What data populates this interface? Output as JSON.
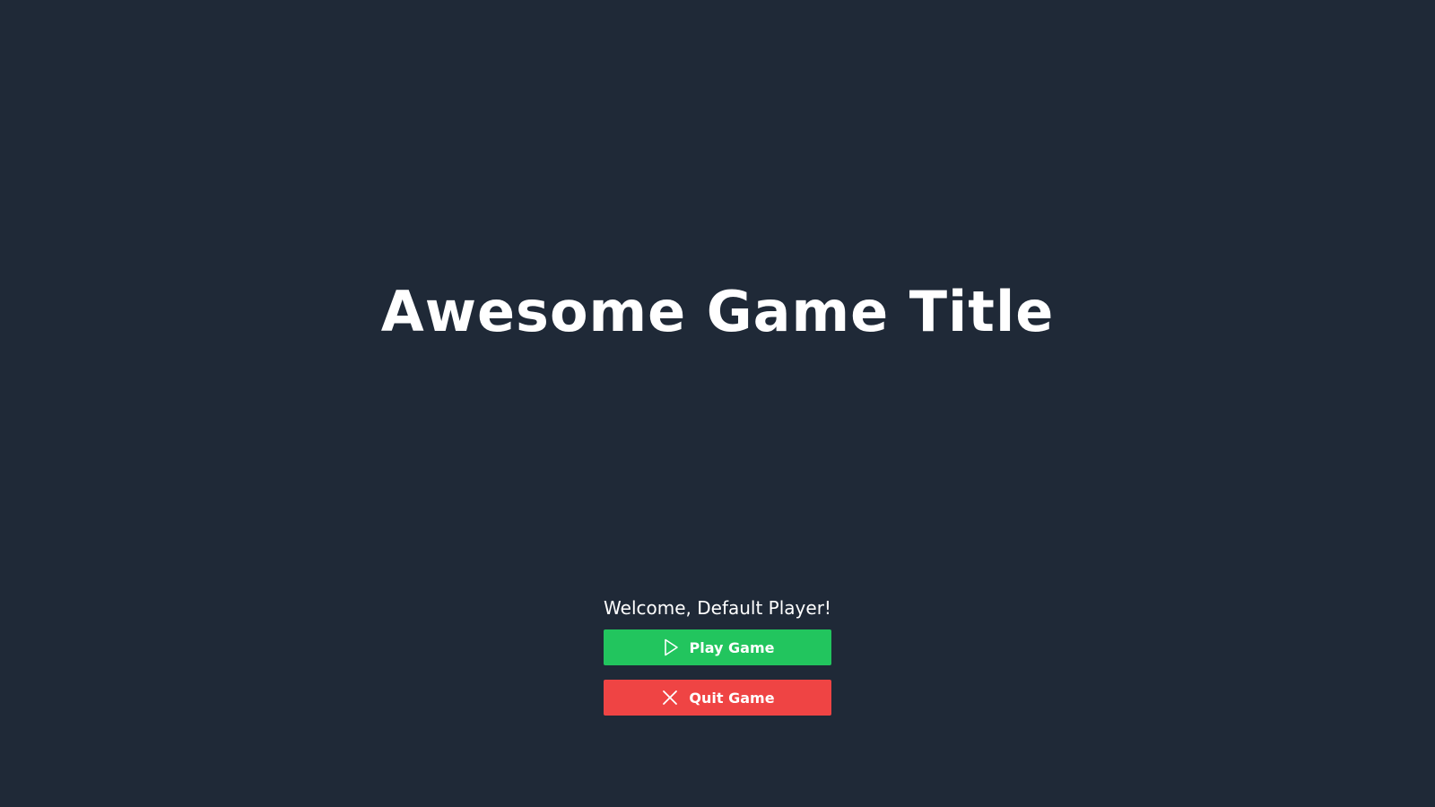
{
  "title": "Awesome Game Title",
  "welcome_text": "Welcome, Default Player!",
  "buttons": {
    "play": {
      "label": "Play Game",
      "icon": "play-icon",
      "color": "#22c55e"
    },
    "quit": {
      "label": "Quit Game",
      "icon": "close-icon",
      "color": "#ef4444"
    }
  },
  "colors": {
    "background": "#1f2937",
    "text": "#ffffff"
  }
}
